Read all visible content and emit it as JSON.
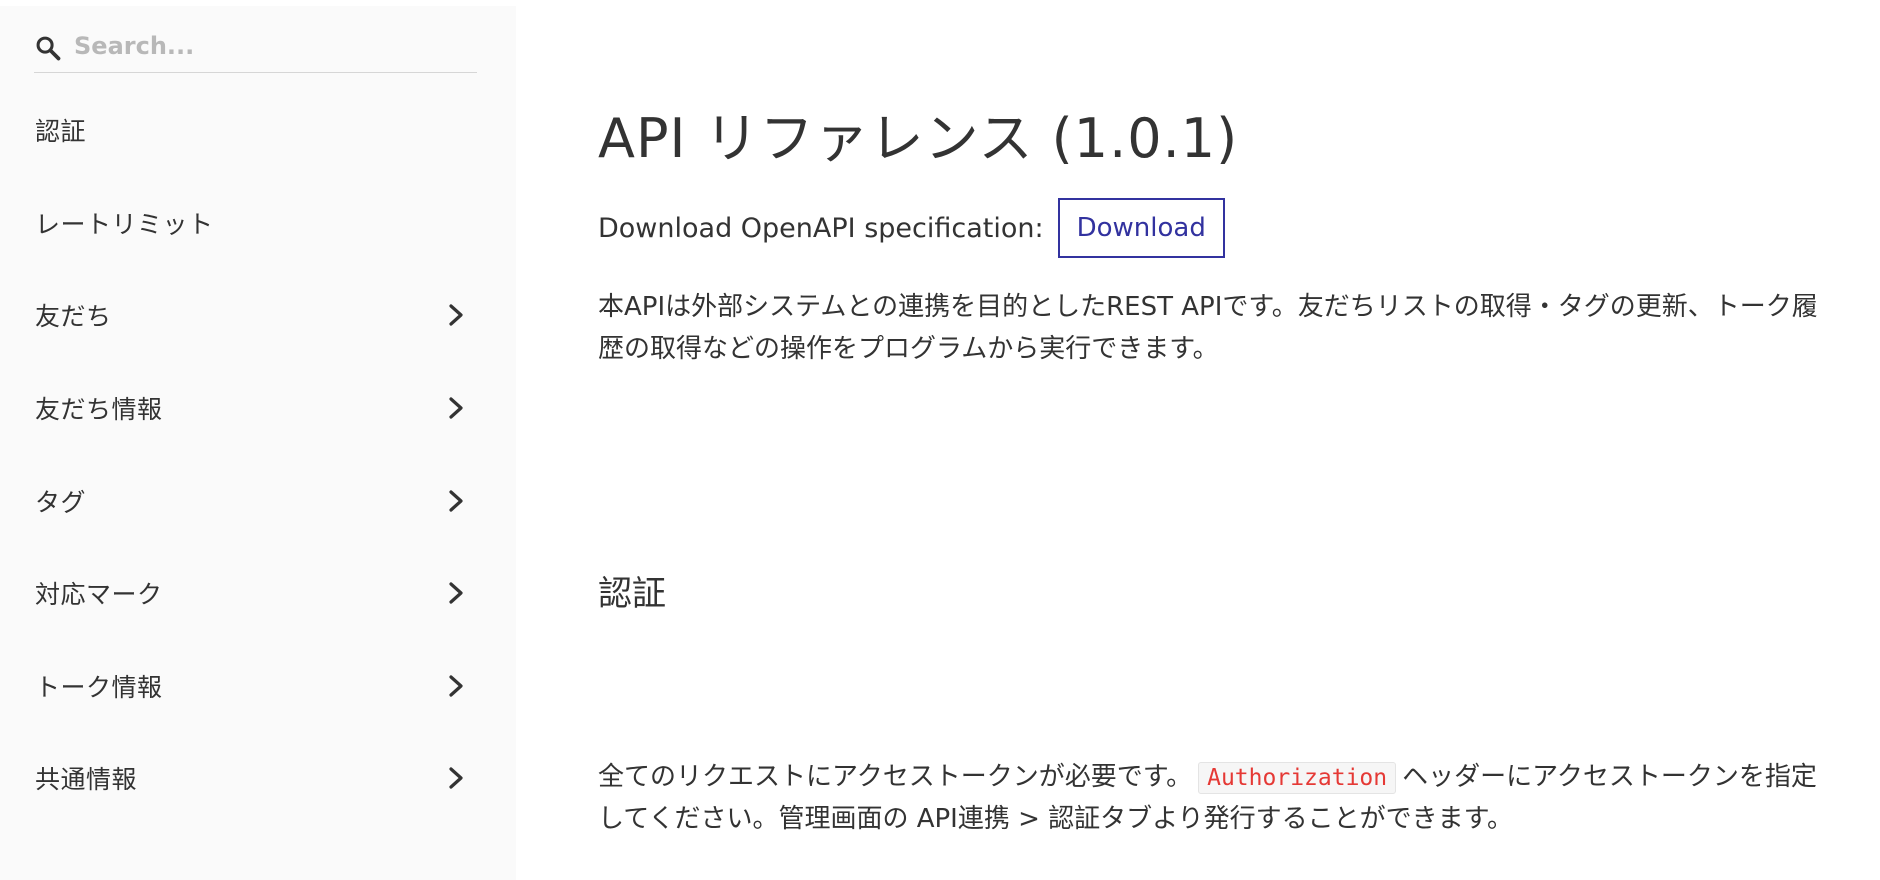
{
  "search": {
    "placeholder": "Search...",
    "icon": "search-icon"
  },
  "sidebar": {
    "items": [
      {
        "label": "認証",
        "expandable": false
      },
      {
        "label": "レートリミット",
        "expandable": false
      },
      {
        "label": "友だち",
        "expandable": true
      },
      {
        "label": "友だち情報",
        "expandable": true
      },
      {
        "label": "タグ",
        "expandable": true
      },
      {
        "label": "対応マーク",
        "expandable": true
      },
      {
        "label": "トーク情報",
        "expandable": true
      },
      {
        "label": "共通情報",
        "expandable": true
      }
    ]
  },
  "main": {
    "title": "API リファレンス (1.0.1)",
    "download_label": "Download OpenAPI specification:",
    "download_button": "Download",
    "intro": "本APIは外部システムとの連携を目的としたREST APIです。友だちリストの取得・タグの更新、トーク履歴の取得などの操作をプログラムから実行できます。",
    "section_title": "認証",
    "auth_text_before": "全てのリクエストにアクセストークンが必要です。",
    "auth_code": "Authorization",
    "auth_text_after": "ヘッダーにアクセストークンを指定してください。管理画面の API連携 > 認証タブより発行することができます。"
  },
  "colors": {
    "sidebar_bg": "#fafafa",
    "accent": "#32329f",
    "code_text": "#e53935",
    "text": "#333333"
  }
}
